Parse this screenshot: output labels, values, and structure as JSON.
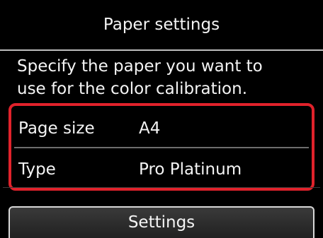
{
  "header": {
    "title": "Paper settings"
  },
  "description": {
    "line1": "Specify the paper you want to",
    "line2": "use for the color calibration."
  },
  "settings": {
    "rows": [
      {
        "label": "Page size",
        "value": "A4"
      },
      {
        "label": "Type",
        "value": "Pro Platinum"
      }
    ],
    "highlight_color": "#e0222b"
  },
  "actions": {
    "settings_label": "Settings"
  }
}
